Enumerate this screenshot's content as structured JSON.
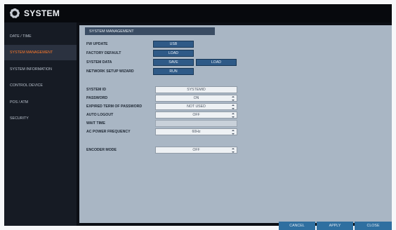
{
  "window": {
    "title": "SYSTEM",
    "icon": "gear-icon"
  },
  "sidebar": {
    "items": [
      {
        "label": "DATE / TIME",
        "active": false
      },
      {
        "label": "SYSTEM MANAGEMENT",
        "active": true
      },
      {
        "label": "SYSTEM INFORMATION",
        "active": false
      },
      {
        "label": "CONTROL DEVICE",
        "active": false
      },
      {
        "label": "POS / ATM",
        "active": false
      },
      {
        "label": "SECURITY",
        "active": false
      }
    ]
  },
  "main": {
    "section_title": "SYSTEM MANAGEMENT",
    "fw_update": {
      "label": "FW UPDATE",
      "button": "USB"
    },
    "factory_default": {
      "label": "FACTORY DEFAULT",
      "button": "LOAD"
    },
    "system_data": {
      "label": "SYSTEM DATA",
      "save": "SAVE",
      "load": "LOAD"
    },
    "network_wizard": {
      "label": "NETWORK SETUP WIZARD",
      "button": "RUN"
    },
    "system_id": {
      "label": "SYSTEM ID",
      "value": "SYSTEMID"
    },
    "password": {
      "label": "PASSWORD",
      "value": "ON"
    },
    "expired_term": {
      "label": "EXPIRED TERM OF PASSWORD",
      "value": "NOT USED"
    },
    "auto_logout": {
      "label": "AUTO LOGOUT",
      "value": "OFF"
    },
    "wait_time": {
      "label": "WAIT TIME",
      "value": ""
    },
    "ac_power": {
      "label": "AC POWER FREQUENCY",
      "value": "60Hz"
    },
    "encoder_mode": {
      "label": "ENCODER MODE",
      "value": "OFF"
    }
  },
  "footer": {
    "cancel": "CANCEL",
    "apply": "APPLY",
    "close": "CLOSE"
  },
  "colors": {
    "accent_active": "#ff7a2a",
    "button_blue": "#2f5a87",
    "panel_bg": "#a9b6c4",
    "sidebar_bg": "#161b24"
  }
}
